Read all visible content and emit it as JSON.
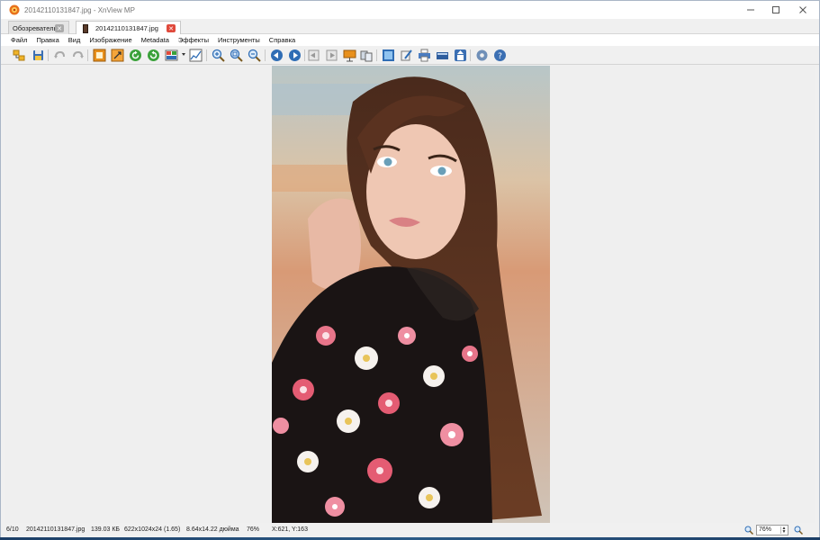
{
  "window": {
    "title": "20142110131847.jpg - XnView MP"
  },
  "tabs": [
    {
      "label": "Обозреватель"
    },
    {
      "label": "20142110131847.jpg"
    }
  ],
  "menu": [
    "Файл",
    "Правка",
    "Вид",
    "Изображение",
    "Metadata",
    "Эффекты",
    "Инструменты",
    "Справка"
  ],
  "toolbar": {
    "icons": [
      "browser-icon",
      "save-icon",
      "undo-icon",
      "redo-icon",
      "crop-icon",
      "resize-icon",
      "rotate-left-icon",
      "rotate-right-icon",
      "adjust-icon",
      "levels-icon",
      "zoom-in-icon",
      "zoom-fit-icon",
      "zoom-out-icon",
      "previous-icon",
      "next-icon",
      "first-icon",
      "last-icon",
      "slideshow-icon",
      "compare-icon",
      "fullscreen-icon",
      "edit-icon",
      "print-icon",
      "scanner-icon",
      "export-icon",
      "settings-icon",
      "help-icon"
    ]
  },
  "status": {
    "index": "6/10",
    "filename": "20142110131847.jpg",
    "filesize": "139.03 КБ",
    "dimensions": "622x1024x24 (1.65)",
    "print_size": "8.64x14.22 дюйма",
    "zoom_percent": "76%",
    "cursor": "X:621, Y:163",
    "zoom_value": "76%"
  },
  "colors": {
    "accent_close": "#e04a3c",
    "toolbar_blue": "#2f6db5",
    "toolbar_green": "#3aa13a",
    "toolbar_orange": "#e8901c"
  }
}
